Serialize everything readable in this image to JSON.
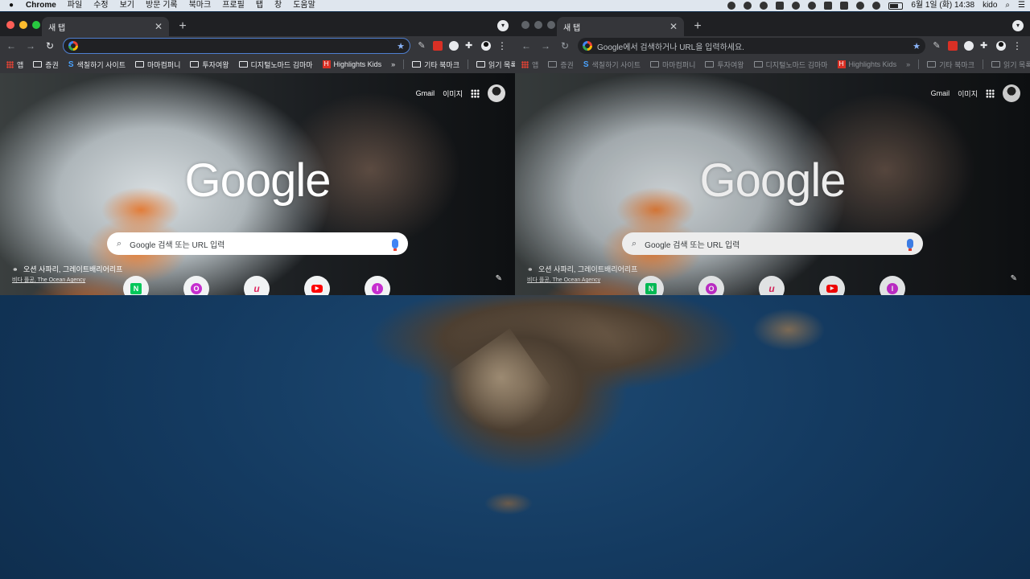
{
  "menubar": {
    "apple": "",
    "app": "Chrome",
    "menus": [
      "파일",
      "수정",
      "보기",
      "방문 기록",
      "북마크",
      "프로필",
      "탭",
      "창",
      "도움말"
    ],
    "clock": "6월 1일 (화) 14:38",
    "user": "kido"
  },
  "windows": [
    {
      "id": "left",
      "focused": true,
      "tab_title": "새 탭",
      "omnibox_text": "",
      "bookmarks": [
        "앱",
        "증권",
        "색칠하기 사이트",
        "마마컴퍼니",
        "투자여왕",
        "디지털노마드 김마마",
        "Highlights Kids"
      ],
      "bookmarks_more": "»",
      "other_bookmarks": "기타 북마크",
      "reading_list": "읽기 목록",
      "ntp": {
        "gmail": "Gmail",
        "images": "이미지",
        "logo": "Google",
        "search_placeholder": "Google 검색 또는 URL 입력",
        "attribution_title": "오션 사파리, 그레이트배리어리프",
        "attribution_sub": "비다 플공, The Ocean Agency",
        "shortcuts": [
          "N",
          "O",
          "u",
          "▶",
          "I"
        ]
      }
    },
    {
      "id": "right",
      "focused": false,
      "tab_title": "새 탭",
      "omnibox_text": "Google에서 검색하거나 URL을 입력하세요.",
      "bookmarks": [
        "앱",
        "증권",
        "색칠하기 사이트",
        "마마컴퍼니",
        "투자여왕",
        "디지털노마드 김마마",
        "Highlights Kids"
      ],
      "bookmarks_more": "»",
      "other_bookmarks": "기타 북마크",
      "reading_list": "읽기 목록",
      "ntp": {
        "gmail": "Gmail",
        "images": "이미지",
        "logo": "Google",
        "search_placeholder": "Google 검색 또는 URL 입력",
        "attribution_title": "오션 사파리, 그레이트배리어리프",
        "attribution_sub": "비다 플공, The Ocean Agency",
        "shortcuts": [
          "N",
          "O",
          "u",
          "▶",
          "I"
        ]
      }
    }
  ],
  "colors": {
    "focus_ring": "#4f7fd0",
    "naver": "#03c75a",
    "youtube": "#ff0000"
  }
}
